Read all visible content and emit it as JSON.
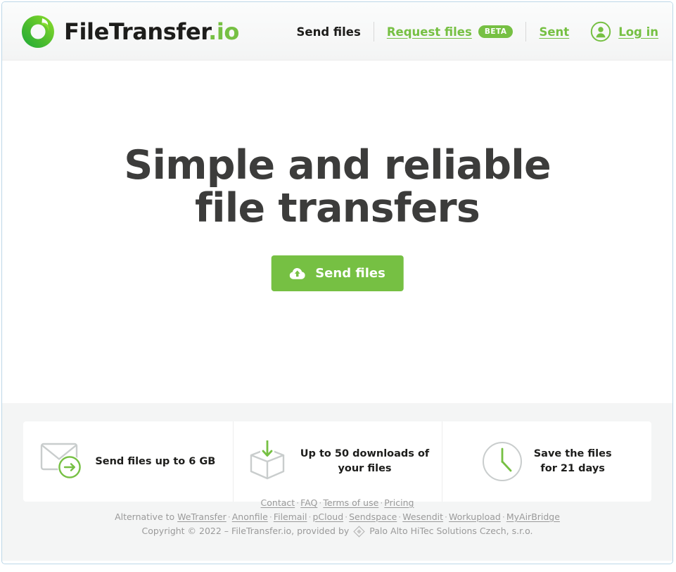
{
  "brand": {
    "name_main": "FileTransfer",
    "name_tld": ".io",
    "logo_icon": "filetransfer-ring-logo",
    "accent_color": "#76c043"
  },
  "nav": {
    "send_files": "Send files",
    "request_files": "Request files",
    "request_files_badge": "BETA",
    "sent": "Sent",
    "login": "Log in",
    "avatar_icon": "user-circle-icon"
  },
  "hero": {
    "title_line1": "Simple and reliable",
    "title_line2": "file transfers",
    "cta_label": "Send files",
    "cta_icon": "cloud-upload-icon"
  },
  "features": [
    {
      "icon": "envelope-arrow-icon",
      "text_line1": "Send files up to 6 GB",
      "text_line2": ""
    },
    {
      "icon": "box-download-icon",
      "text_line1": "Up to 50 downloads of",
      "text_line2": "your files"
    },
    {
      "icon": "clock-icon",
      "text_line1": "Save the files",
      "text_line2": "for 21 days"
    }
  ],
  "footer": {
    "links_primary": [
      "Contact",
      "FAQ",
      "Terms of use",
      "Pricing"
    ],
    "alternative_prefix": "Alternative to",
    "alternatives": [
      "WeTransfer",
      "Anonfile",
      "Filemail",
      "pCloud",
      "Sendspace",
      "Wesendit",
      "Workupload",
      "MyAirBridge"
    ],
    "copyright_prefix": "Copyright © 2022 – FileTransfer.io, provided by",
    "provider_icon": "diamond-logo-icon",
    "provider_name": "Palo Alto HiTec Solutions Czech, s.r.o.",
    "separator": "·"
  }
}
